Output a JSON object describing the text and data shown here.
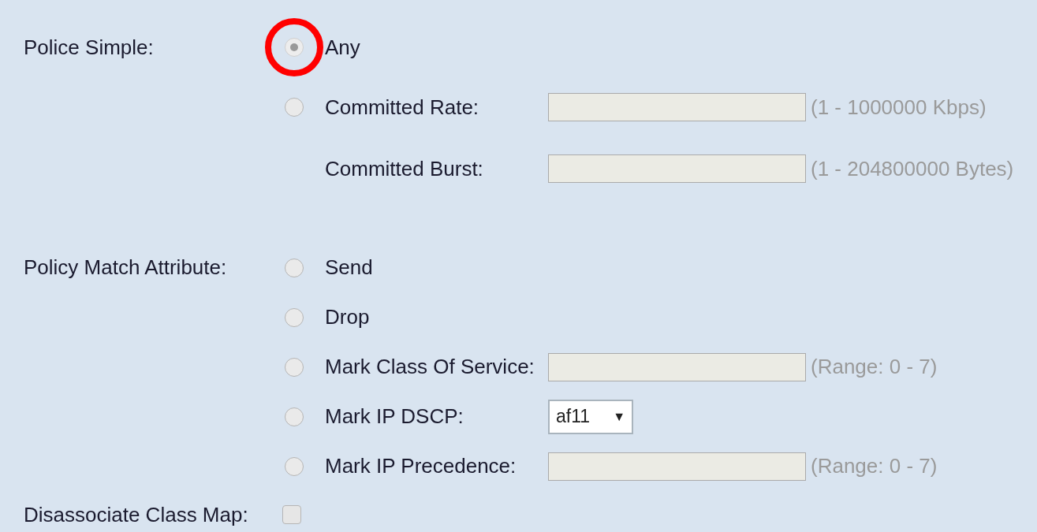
{
  "sections": [
    {
      "label": "Police Simple:",
      "options": [
        {
          "kind": "radio",
          "label": "Any",
          "selected": true,
          "disabled": true,
          "highlighted": true
        },
        {
          "kind": "radio",
          "label": "Committed Rate:",
          "selected": false,
          "disabled": false,
          "highlighted": false,
          "input": {
            "kind": "text",
            "disabled": true
          },
          "hint": "(1 - 1000000 Kbps)"
        },
        {
          "kind": "field",
          "label": "Committed Burst:",
          "input": {
            "kind": "text",
            "disabled": true
          },
          "hint": "(1 - 204800000 Bytes)"
        }
      ]
    },
    {
      "label": "Policy Match Attribute:",
      "options": [
        {
          "kind": "radio",
          "label": "Send",
          "selected": false,
          "disabled": false,
          "highlighted": false
        },
        {
          "kind": "radio",
          "label": "Drop",
          "selected": false,
          "disabled": false,
          "highlighted": false
        },
        {
          "kind": "radio",
          "label": "Mark Class Of Service:",
          "selected": false,
          "disabled": false,
          "highlighted": false,
          "input": {
            "kind": "text",
            "disabled": true
          },
          "hint": "(Range: 0 - 7)"
        },
        {
          "kind": "radio",
          "label": "Mark IP DSCP:",
          "selected": false,
          "disabled": false,
          "highlighted": false,
          "input": {
            "kind": "select",
            "value": "af11",
            "arrow": "▼"
          }
        },
        {
          "kind": "radio",
          "label": "Mark IP Precedence:",
          "selected": false,
          "disabled": false,
          "highlighted": false,
          "input": {
            "kind": "text",
            "disabled": true
          },
          "hint": "(Range: 0 - 7)"
        }
      ]
    }
  ],
  "disassociate": {
    "label": "Disassociate Class Map:",
    "checked": false
  }
}
